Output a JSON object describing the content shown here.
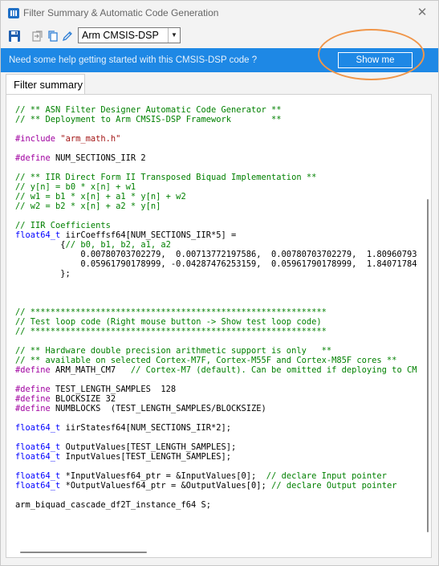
{
  "window": {
    "title": "Filter Summary & Automatic Code Generation",
    "close_glyph": "✕"
  },
  "toolbar": {
    "framework_selected": "Arm CMSIS-DSP",
    "icons": [
      "save-icon",
      "export-icon",
      "copy-icon",
      "edit-icon"
    ]
  },
  "help_banner": {
    "text": "Need some help getting started with this CMSIS-DSP code ?",
    "button_label": "Show me",
    "color": "#1e88e5"
  },
  "annotation": {
    "color": "#f0964a"
  },
  "tabs": [
    {
      "label": "Filter summary",
      "active": true
    }
  ],
  "code": {
    "lines": [
      [
        {
          "t": "// ** ASN Filter Designer Automatic Code Generator **",
          "c": "comment"
        }
      ],
      [
        {
          "t": "// ** Deployment to Arm CMSIS-DSP Framework        **",
          "c": "comment"
        }
      ],
      [],
      [
        {
          "t": "#include ",
          "c": "pre"
        },
        {
          "t": "\"arm_math.h\"",
          "c": "str"
        }
      ],
      [],
      [
        {
          "t": "#define",
          "c": "pre"
        },
        {
          "t": " NUM_SECTIONS_IIR 2",
          "c": ""
        }
      ],
      [],
      [
        {
          "t": "// ** IIR Direct Form II Transposed Biquad Implementation **",
          "c": "comment"
        }
      ],
      [
        {
          "t": "// y[n] = b0 * x[n] + w1",
          "c": "comment"
        }
      ],
      [
        {
          "t": "// w1 = b1 * x[n] + a1 * y[n] + w2",
          "c": "comment"
        }
      ],
      [
        {
          "t": "// w2 = b2 * x[n] + a2 * y[n]",
          "c": "comment"
        }
      ],
      [],
      [
        {
          "t": "// IIR Coefficients",
          "c": "comment"
        }
      ],
      [
        {
          "t": "float64_t",
          "c": "type"
        },
        {
          "t": " iirCoeffsf64[NUM_SECTIONS_IIR*5] =",
          "c": ""
        }
      ],
      [
        {
          "t": "         {",
          "c": ""
        },
        {
          "t": "// b0, b1, b2, a1, a2",
          "c": "comment"
        }
      ],
      [
        {
          "t": "             0.00780703702279,  0.00713772197586,  0.00780703702279,  1.80960793",
          "c": ""
        }
      ],
      [
        {
          "t": "             0.05961790178999, -0.04287476253159,  0.05961790178999,  1.84071784",
          "c": ""
        }
      ],
      [
        {
          "t": "         };",
          "c": ""
        }
      ],
      [],
      [],
      [],
      [
        {
          "t": "// ***********************************************************",
          "c": "comment"
        }
      ],
      [
        {
          "t": "// Test loop code (Right mouse button -> Show test loop code)",
          "c": "comment"
        }
      ],
      [
        {
          "t": "// ***********************************************************",
          "c": "comment"
        }
      ],
      [],
      [
        {
          "t": "// ** Hardware double precision arithmetic support is only   **",
          "c": "comment"
        }
      ],
      [
        {
          "t": "// ** available on selected Cortex-M7F, Cortex-M55F and Cortex-M85F cores **",
          "c": "comment"
        }
      ],
      [
        {
          "t": "#define",
          "c": "pre"
        },
        {
          "t": " ARM_MATH_CM7   ",
          "c": ""
        },
        {
          "t": "// Cortex-M7 (default). Can be omitted if deploying to CM",
          "c": "comment"
        }
      ],
      [],
      [
        {
          "t": "#define",
          "c": "pre"
        },
        {
          "t": " TEST_LENGTH_SAMPLES  128",
          "c": ""
        }
      ],
      [
        {
          "t": "#define",
          "c": "pre"
        },
        {
          "t": " BLOCKSIZE 32",
          "c": ""
        }
      ],
      [
        {
          "t": "#define",
          "c": "pre"
        },
        {
          "t": " NUMBLOCKS  (TEST_LENGTH_SAMPLES/BLOCKSIZE)",
          "c": ""
        }
      ],
      [],
      [
        {
          "t": "float64_t",
          "c": "type"
        },
        {
          "t": " iirStatesf64[NUM_SECTIONS_IIR*2];",
          "c": ""
        }
      ],
      [],
      [
        {
          "t": "float64_t",
          "c": "type"
        },
        {
          "t": " OutputValues[TEST_LENGTH_SAMPLES];",
          "c": ""
        }
      ],
      [
        {
          "t": "float64_t",
          "c": "type"
        },
        {
          "t": " InputValues[TEST_LENGTH_SAMPLES];",
          "c": ""
        }
      ],
      [],
      [
        {
          "t": "float64_t",
          "c": "type"
        },
        {
          "t": " *InputValuesf64_ptr = &InputValues[0];  ",
          "c": ""
        },
        {
          "t": "// declare Input pointer",
          "c": "comment"
        }
      ],
      [
        {
          "t": "float64_t",
          "c": "type"
        },
        {
          "t": " *OutputValuesf64_ptr = &OutputValues[0]; ",
          "c": ""
        },
        {
          "t": "// declare Output pointer",
          "c": "comment"
        }
      ],
      [],
      [
        {
          "t": "arm_biquad_cascade_df2T_instance_f64 S;",
          "c": ""
        }
      ]
    ]
  }
}
